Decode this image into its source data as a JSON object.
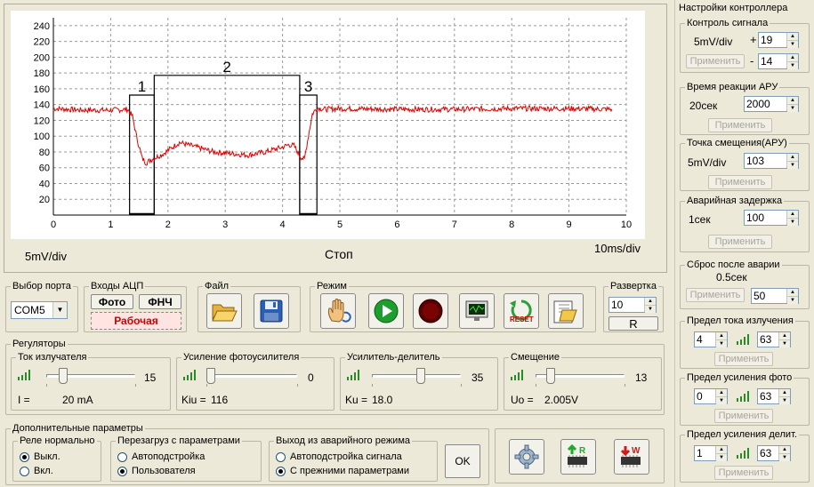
{
  "chart_data": {
    "type": "line",
    "xlim": [
      0,
      10
    ],
    "ylim": [
      0,
      250
    ],
    "x_ticks": [
      "0",
      "1",
      "2",
      "3",
      "4",
      "5",
      "6",
      "7",
      "8",
      "9",
      "10"
    ],
    "y_ticks": [
      "20",
      "40",
      "60",
      "80",
      "100",
      "120",
      "140",
      "160",
      "180",
      "200",
      "220",
      "240"
    ],
    "grid": true,
    "series": [
      {
        "color": "#e00000",
        "x": [
          0,
          0.5,
          1.0,
          1.3,
          1.38,
          1.45,
          1.55,
          1.62,
          1.7,
          1.9,
          2.2,
          2.5,
          2.8,
          3.1,
          3.4,
          3.7,
          4.0,
          4.1,
          4.2,
          4.3,
          4.38,
          4.45,
          4.52,
          4.6,
          4.75,
          5,
          6,
          7,
          8,
          9,
          9.75
        ],
        "y": [
          135,
          133,
          133,
          134,
          125,
          100,
          72,
          66,
          70,
          77,
          92,
          86,
          80,
          78,
          76,
          80,
          86,
          89,
          88,
          75,
          70,
          100,
          128,
          136,
          134,
          135,
          134,
          134,
          135,
          135,
          134
        ]
      }
    ],
    "markers": [
      {
        "label": "1",
        "x0": 1.33,
        "x1": 1.76,
        "y": 152
      },
      {
        "label": "2",
        "x0": 1.76,
        "x1": 4.3,
        "y": 177
      },
      {
        "label": "3",
        "x0": 4.3,
        "x1": 4.6,
        "y": 152
      }
    ]
  },
  "scope": {
    "vscale": "5mV/div",
    "status": "Стоп",
    "tscale": "10ms/div"
  },
  "port": {
    "legend": "Выбор порта",
    "value": "COM5"
  },
  "adc": {
    "legend": "Входы АЦП",
    "btn_photo": "Фото",
    "btn_lpf": "ФНЧ",
    "state": "Рабочая"
  },
  "file": {
    "legend": "Файл"
  },
  "mode": {
    "legend": "Режим"
  },
  "sweep": {
    "legend": "Развертка",
    "value": "10",
    "r_label": "R"
  },
  "regulators": {
    "legend": "Регуляторы",
    "items": [
      {
        "title": "Ток излучателя",
        "value": "15",
        "sub_label": "I =",
        "sub_value": "20 mA",
        "pos": 0.15
      },
      {
        "title": "Усиление фотоусилителя",
        "value": "0",
        "sub_label": "Kiu =",
        "sub_value": "116",
        "pos": 0.0
      },
      {
        "title": "Усилитель-делитель",
        "value": "35",
        "sub_label": "Ku =",
        "sub_value": "18.0",
        "pos": 0.55
      },
      {
        "title": "Смещение",
        "value": "13",
        "sub_label": "Uo =",
        "sub_value": "2.005V",
        "pos": 0.13
      }
    ]
  },
  "extra": {
    "legend": "Дополнительные параметры",
    "relay": {
      "legend": "Реле нормально",
      "options": [
        "Выкл.",
        "Вкл."
      ],
      "selected": 0
    },
    "reload": {
      "legend": "Перезагруз с параметрами",
      "options": [
        "Автоподстройка",
        "Пользователя"
      ],
      "selected": 1
    },
    "exit": {
      "legend": "Выход из аварийного режима",
      "options": [
        "Автоподстройка  сигнала",
        "С прежними параметрами"
      ],
      "selected": 1
    },
    "ok_label": "OK"
  },
  "settings": {
    "title": "Настройки контроллера",
    "apply_label": "Применить",
    "signal": {
      "legend": "Контроль сигнала",
      "unit": "5mV/div",
      "plus": "+",
      "minus": "-",
      "v1": "19",
      "v2": "14"
    },
    "agc_time": {
      "legend": "Время реакции АРУ",
      "label": "20сек",
      "value": "2000"
    },
    "offset_point": {
      "legend": "Точка смещения(АРУ)",
      "label": "5mV/div",
      "value": "103"
    },
    "alarm_delay": {
      "legend": "Аварийная задержка",
      "label": "1сек",
      "value": "100"
    },
    "reset_after": {
      "legend": "Сброс после аварии",
      "label": "0.5сек",
      "value": "50"
    },
    "current_limit": {
      "legend": "Предел тока излучения",
      "v1": "4",
      "v2": "63"
    },
    "photo_limit": {
      "legend": "Предел усиления фото",
      "v1": "0",
      "v2": "63"
    },
    "div_limit": {
      "legend": "Предел усиления делит.",
      "v1": "1",
      "v2": "63"
    }
  }
}
